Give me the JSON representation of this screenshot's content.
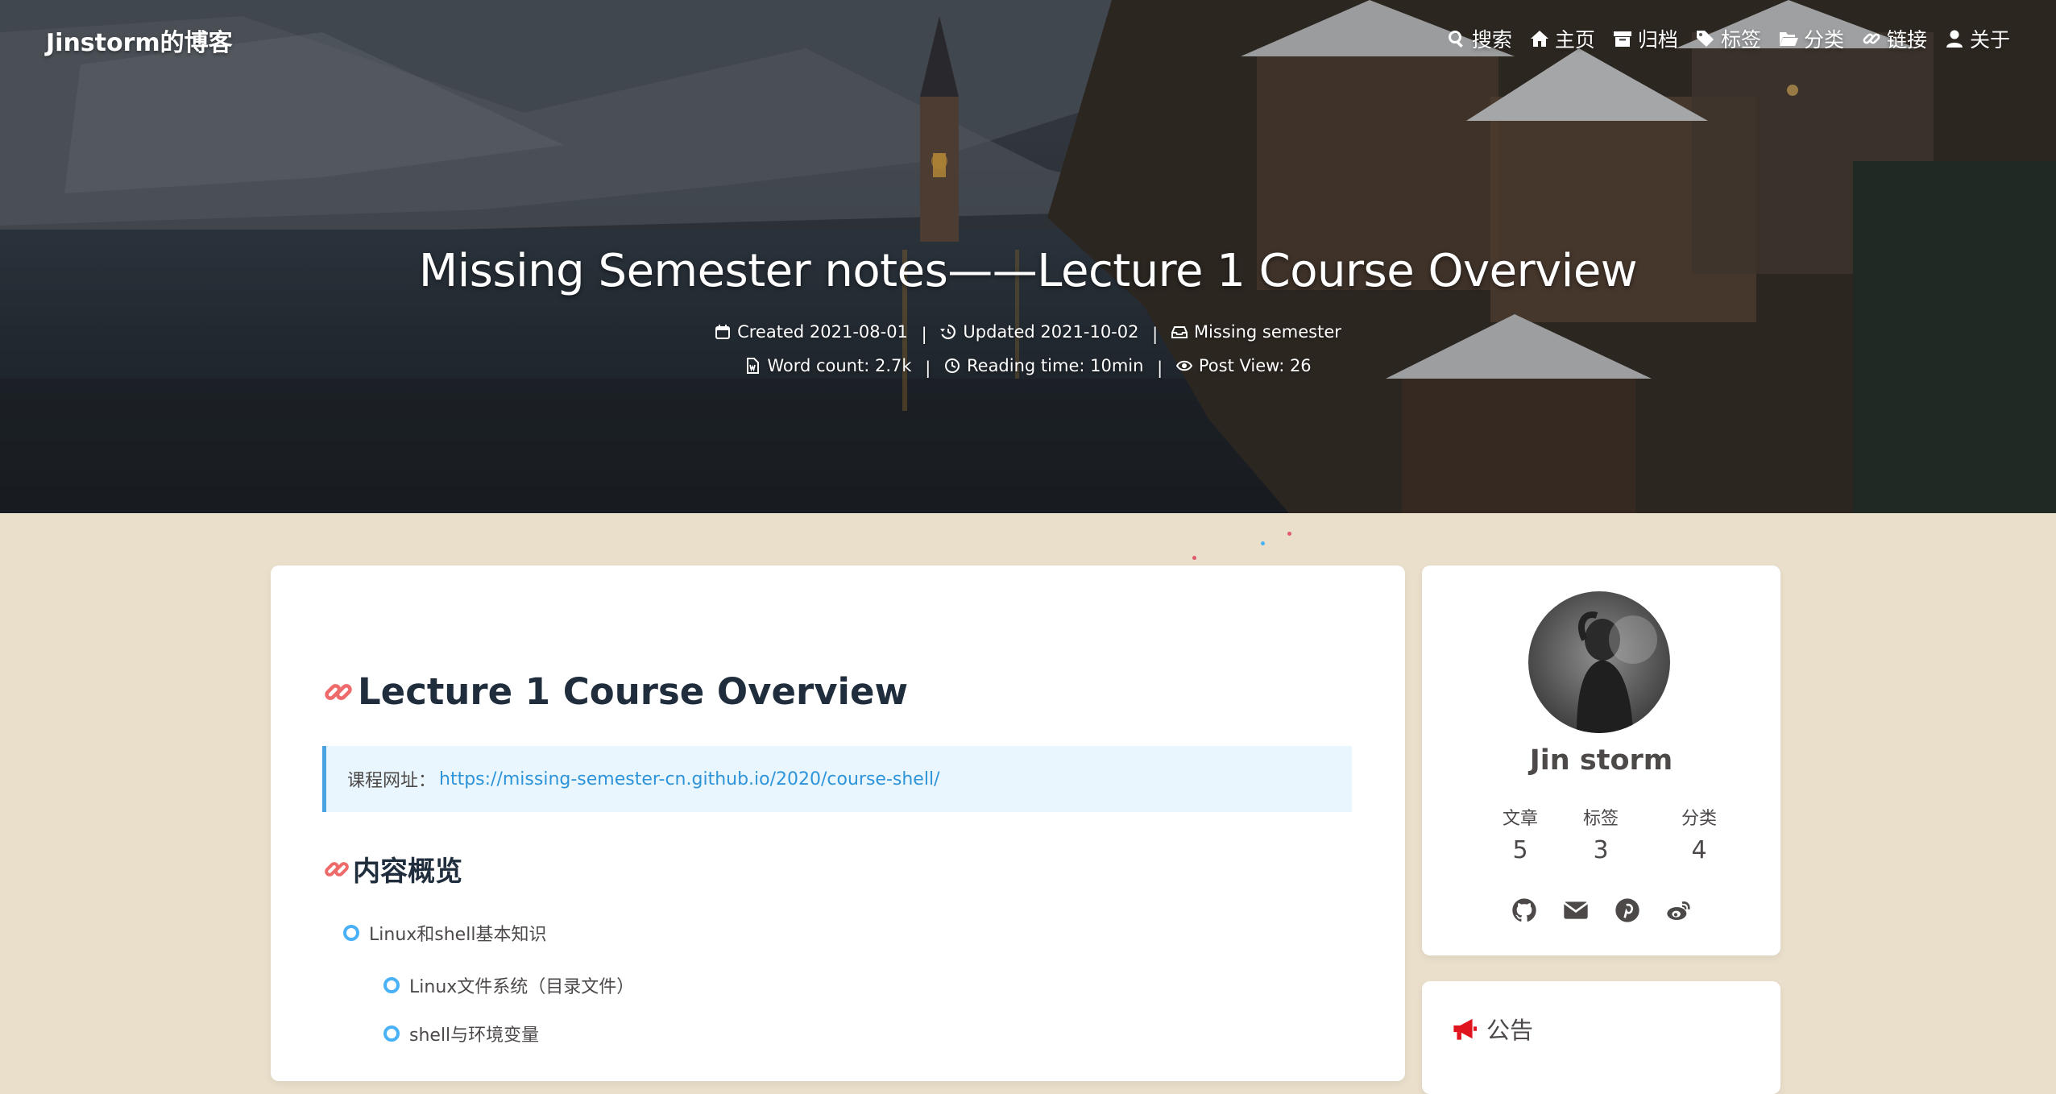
{
  "header": {
    "site_name": "Jinstorm的博客",
    "menu": [
      {
        "label": "搜索",
        "icon": "search-icon"
      },
      {
        "label": "主页",
        "icon": "home-icon"
      },
      {
        "label": "归档",
        "icon": "archive-icon"
      },
      {
        "label": "标签",
        "icon": "tags-icon"
      },
      {
        "label": "分类",
        "icon": "folder-open-icon"
      },
      {
        "label": "链接",
        "icon": "link-icon"
      },
      {
        "label": "关于",
        "icon": "user-icon"
      }
    ]
  },
  "post": {
    "title": "Missing Semester notes——Lecture 1 Course Overview",
    "created": "Created 2021-08-01",
    "updated": "Updated 2021-10-02",
    "category": "Missing semester",
    "word_count": "Word count: 2.7k",
    "reading_time": "Reading time: 10min",
    "post_view": "Post View: 26",
    "separator": "|"
  },
  "content": {
    "heading1": "Lecture 1 Course Overview",
    "note_label": "课程网址：",
    "note_link": "https://missing-semester-cn.github.io/2020/course-shell/",
    "heading2": "内容概览",
    "list": [
      "Linux和shell基本知识",
      "Linux文件系统（目录文件）",
      "shell与环境变量"
    ]
  },
  "sidebar": {
    "author_name": "Jin storm",
    "stats": [
      {
        "label": "文章",
        "value": "5"
      },
      {
        "label": "标签",
        "value": "3"
      },
      {
        "label": "分类",
        "value": "4"
      }
    ],
    "socials": [
      "github-icon",
      "envelope-icon",
      "pinterest-icon",
      "weibo-icon"
    ],
    "announcement_title": "公告"
  },
  "colors": {
    "page_bg": "#e9dfcb",
    "accent_blue": "#49b1f5",
    "link_blue": "#2e94d9",
    "anchor_red": "#ef6a6a",
    "announce_red": "#e0141e"
  }
}
